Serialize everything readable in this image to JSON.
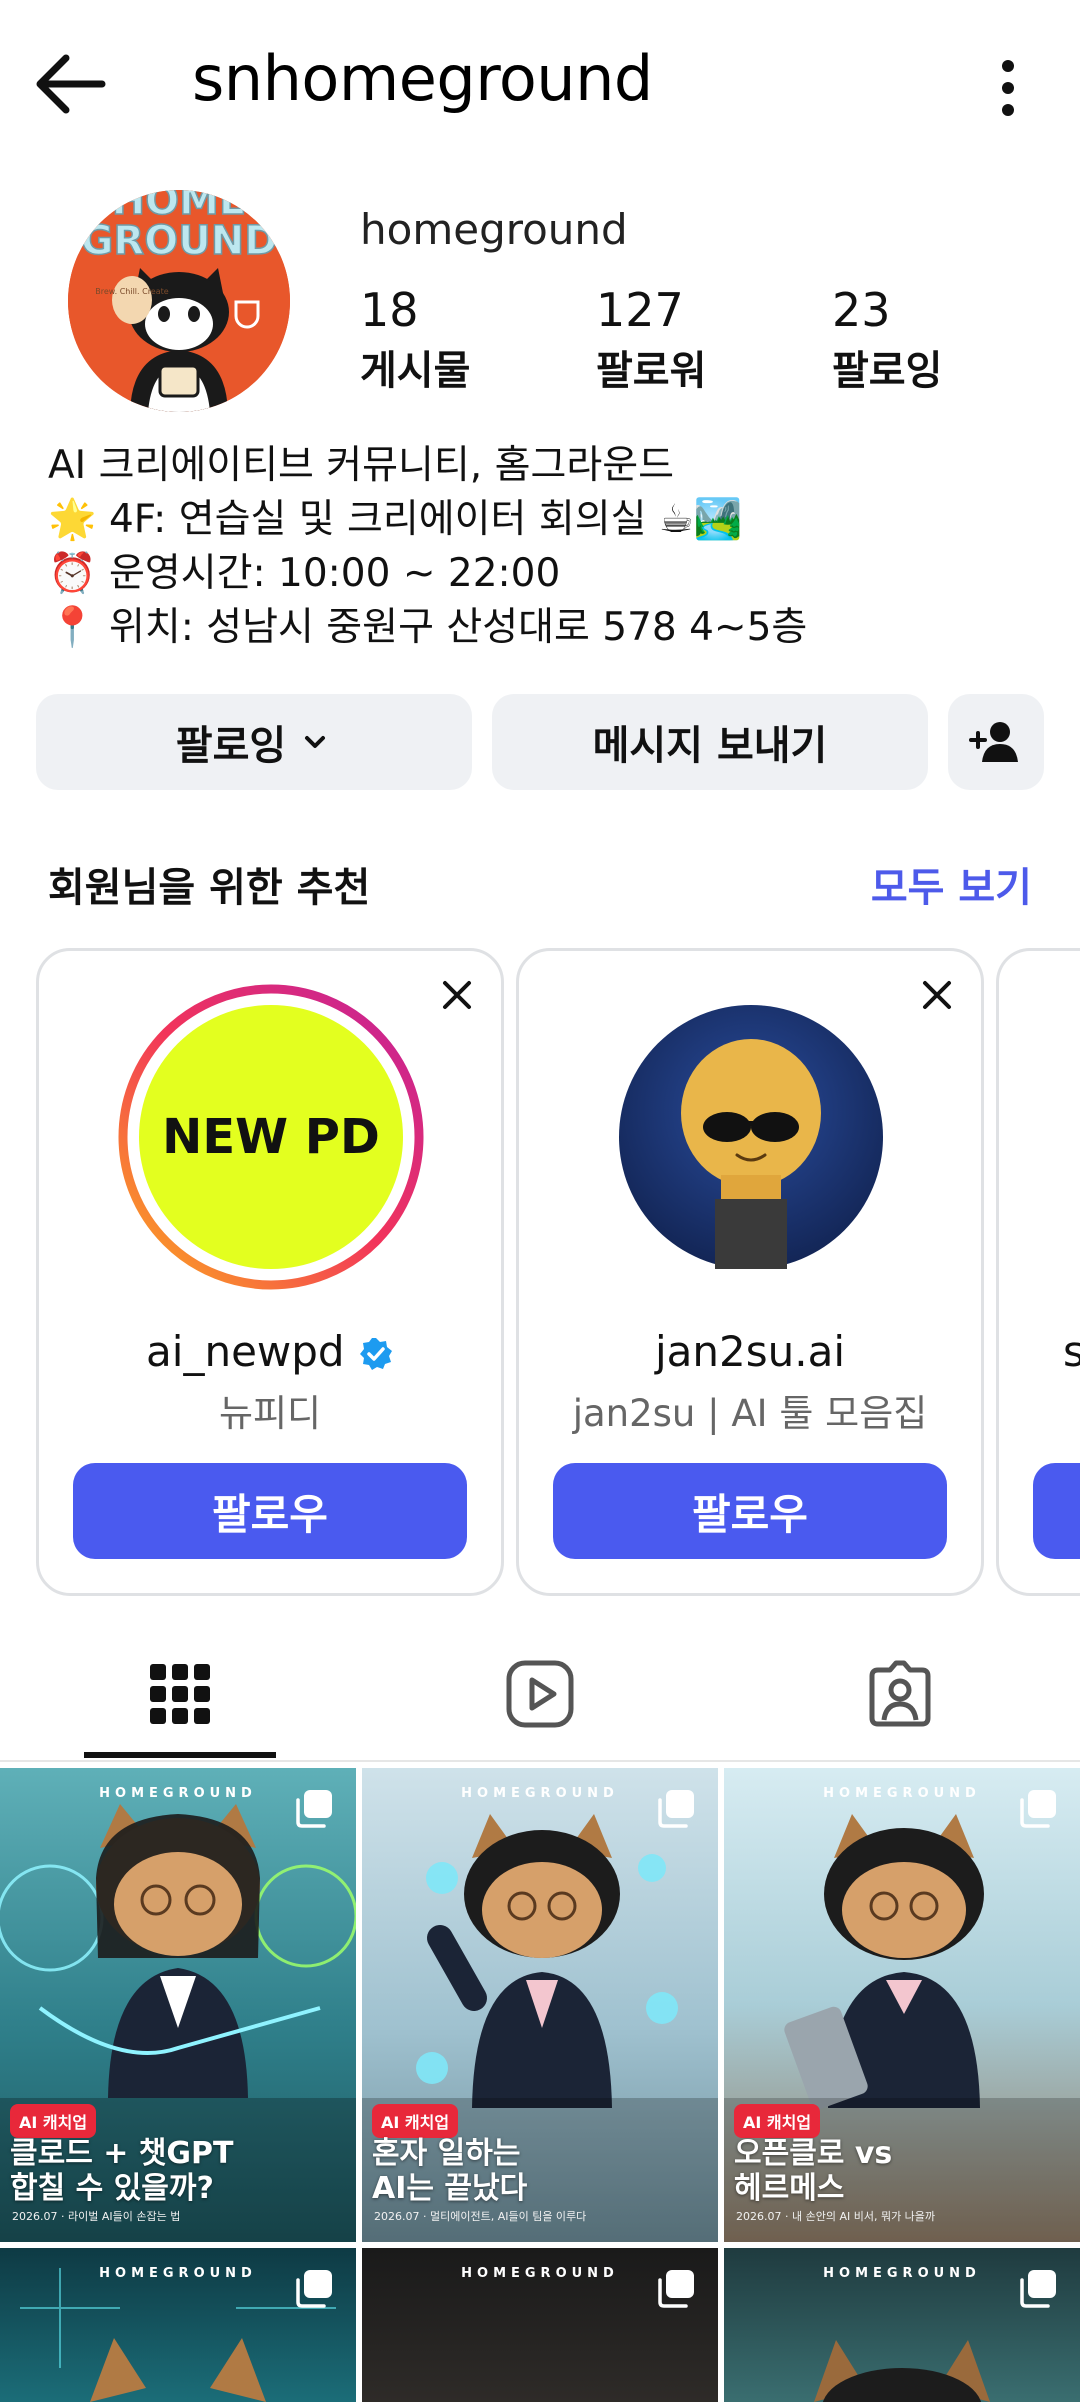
{
  "header": {
    "title": "snhomeground"
  },
  "profile": {
    "username": "homeground",
    "avatar_text": [
      "HOME",
      "GROUND"
    ],
    "avatar_cup_text": "Brew. Chill. Create",
    "stats": [
      {
        "value": "18",
        "label": "게시물"
      },
      {
        "value": "127",
        "label": "팔로워"
      },
      {
        "value": "23",
        "label": "팔로잉"
      }
    ],
    "bio": [
      {
        "icon": "",
        "text": "AI 크리에이티브 커뮤니티, 홈그라운드"
      },
      {
        "icon": "🌟",
        "text": "4F: 연습실 및 크리에이터 회의실 ☕🏞️"
      },
      {
        "icon": "⏰",
        "text": "운영시간: 10:00 ~ 22:00"
      },
      {
        "icon": "📍",
        "text": "위치: 성남시 중원구 산성대로 578 4~5층"
      }
    ]
  },
  "actions": {
    "following": "팔로잉",
    "message": "메시지 보내기"
  },
  "suggestions": {
    "title": "회원님을 위한 추천",
    "see_all": "모두 보기",
    "cards": [
      {
        "name": "ai_newpd",
        "sub": "뉴피디",
        "avatar_text": "NEW PD",
        "follow": "팔로우"
      },
      {
        "name": "jan2su.ai",
        "sub": "jan2su | AI 툴 모음집",
        "follow": "팔로우"
      },
      {
        "name": "s"
      }
    ]
  },
  "grid": {
    "watermark": "HOMEGROUND",
    "tiles": [
      {
        "badge": "AI 캐치업",
        "caption": [
          "클로드 + 챗GPT",
          "합칠 수 있을까?"
        ],
        "small": "2026.07 · 라이벌 AI들이 손잡는 법"
      },
      {
        "badge": "AI 캐치업",
        "caption": [
          "혼자 일하는",
          "AI는 끝났다"
        ],
        "small": "2026.07 · 멀티에이전트, AI들이 팀을 이루다"
      },
      {
        "badge": "AI 캐치업",
        "caption": [
          "오픈클로 vs",
          "헤르메스"
        ],
        "small": "2026.07 · 내 손안의 AI 비서, 뭐가 나을까"
      },
      {
        "badge": "",
        "caption": [],
        "small": ""
      },
      {
        "badge": "",
        "caption": [],
        "small": ""
      },
      {
        "badge": "",
        "caption": [],
        "small": ""
      }
    ]
  },
  "colors": {
    "accent": "#4a5aef",
    "link": "#4d5aea",
    "badge": "#e8283a"
  }
}
